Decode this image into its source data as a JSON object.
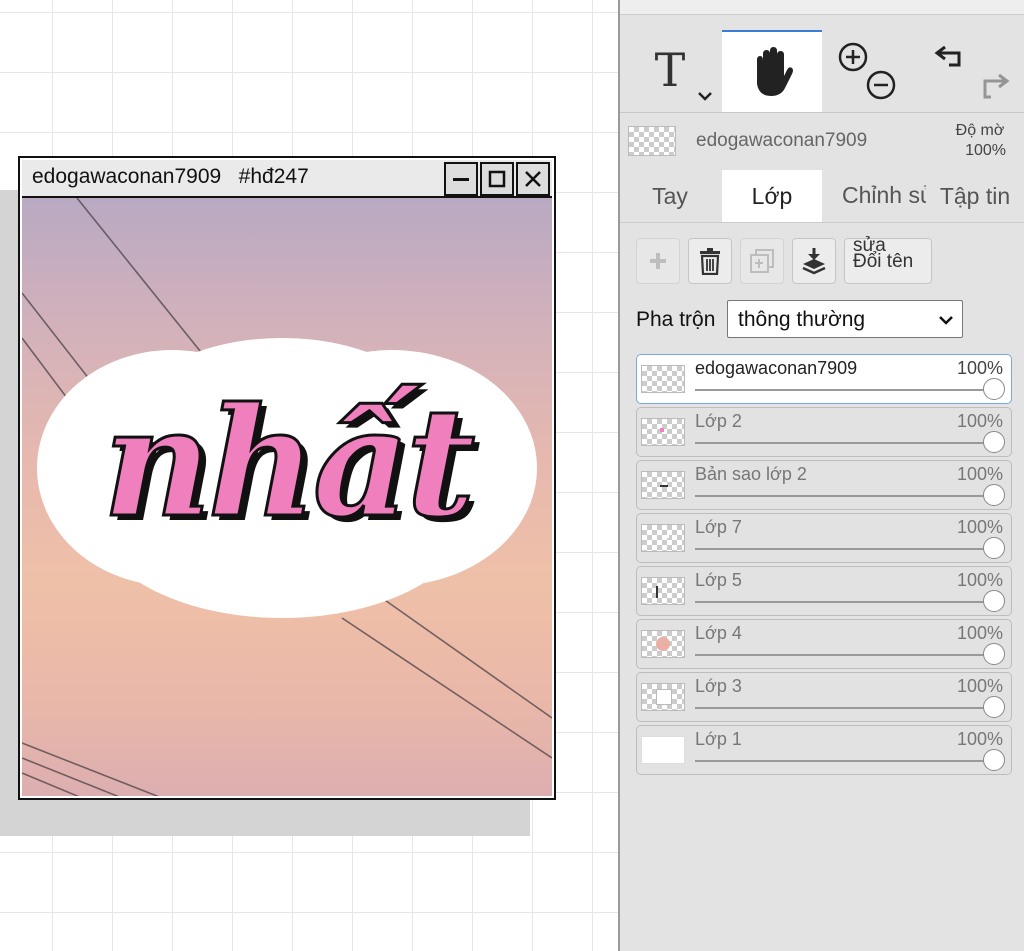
{
  "window": {
    "title": "edogawaconan7909   #hđ247",
    "artwork_text": "nhất"
  },
  "toolbar": {
    "text_tool": "T"
  },
  "layer_header": {
    "name": "edogawaconan7909",
    "opacity_label": "Độ mờ",
    "opacity_value": "100%"
  },
  "tabs": [
    {
      "label": "Tay",
      "active": false
    },
    {
      "label": "Lớp",
      "active": true
    },
    {
      "label": "Chỉnh sửa",
      "active": false
    },
    {
      "label": "Tập tin",
      "active": false
    }
  ],
  "actions": {
    "rename_label": "Đổi tên",
    "rename_overflow": "sửa"
  },
  "blend": {
    "label": "Pha trộn",
    "selected": "thông thường"
  },
  "layers": [
    {
      "name": "edogawaconan7909",
      "opacity": "100%",
      "selected": true
    },
    {
      "name": "Lớp 2",
      "opacity": "100%",
      "selected": false
    },
    {
      "name": "Bản sao lớp 2",
      "opacity": "100%",
      "selected": false
    },
    {
      "name": "Lớp 7",
      "opacity": "100%",
      "selected": false
    },
    {
      "name": "Lớp 5",
      "opacity": "100%",
      "selected": false
    },
    {
      "name": "Lớp 4",
      "opacity": "100%",
      "selected": false
    },
    {
      "name": "Lớp 3",
      "opacity": "100%",
      "selected": false
    },
    {
      "name": "Lớp 1",
      "opacity": "100%",
      "selected": false
    }
  ],
  "colors": {
    "accent": "#3a7bd5",
    "lettering_pink": "#f07fbd",
    "panel_bg": "#e3e3e3"
  }
}
